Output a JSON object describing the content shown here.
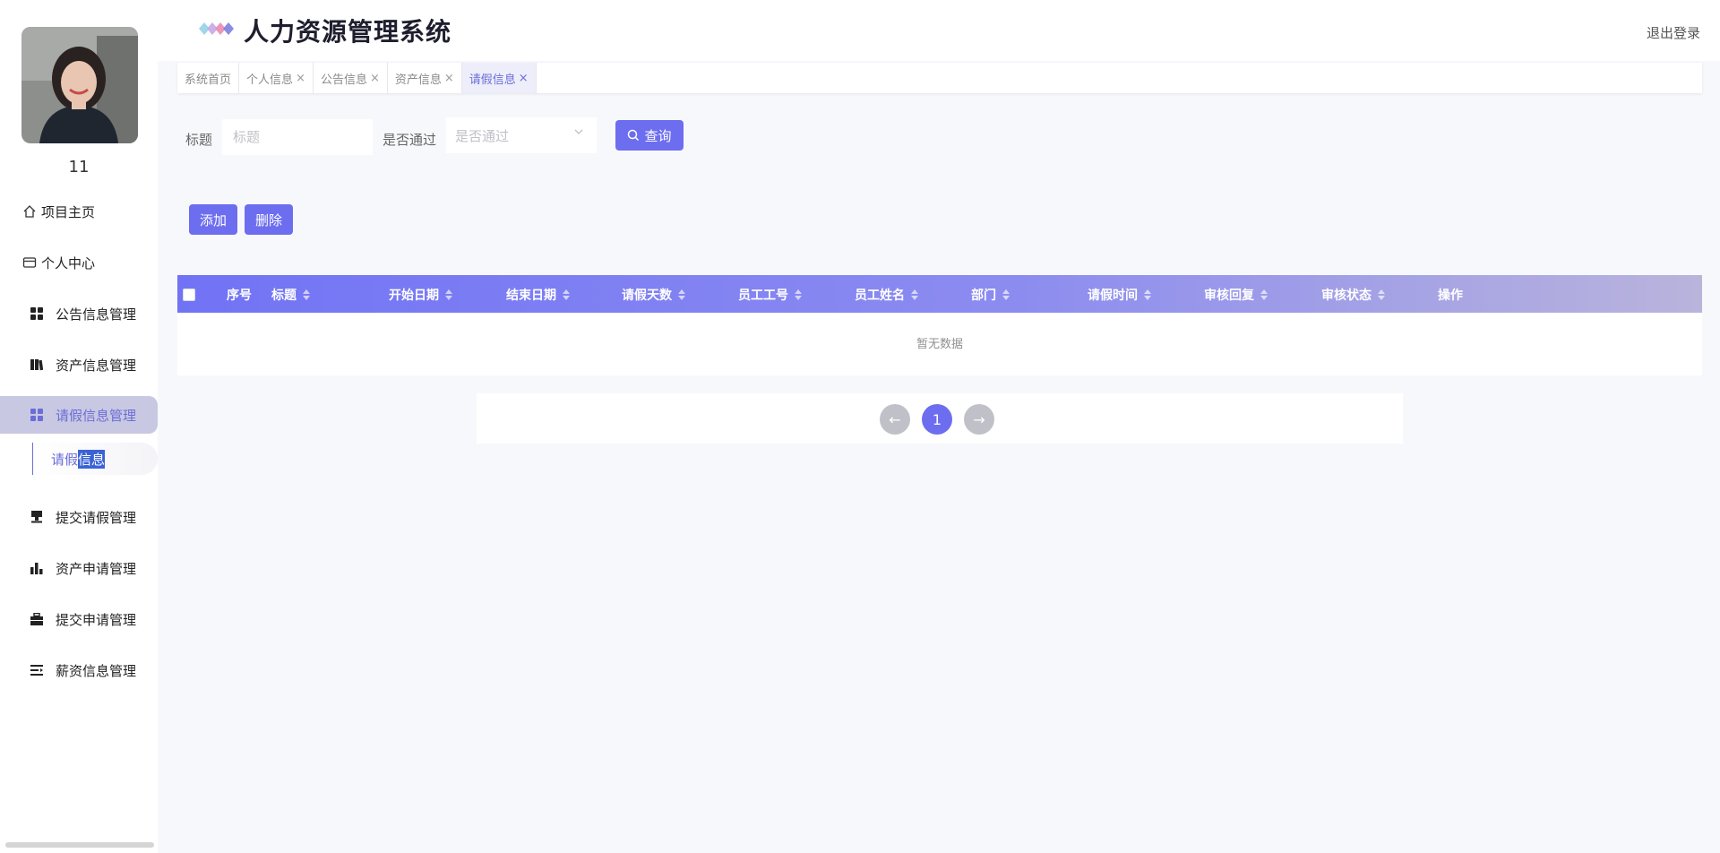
{
  "sidebar": {
    "username": "11",
    "items": [
      {
        "label": "项目主页"
      },
      {
        "label": "个人中心"
      },
      {
        "label": "公告信息管理"
      },
      {
        "label": "资产信息管理"
      },
      {
        "label": "请假信息管理"
      },
      {
        "label": "提交请假管理"
      },
      {
        "label": "资产申请管理"
      },
      {
        "label": "提交申请管理"
      },
      {
        "label": "薪资信息管理"
      }
    ],
    "sub_item": {
      "prefix": "请假",
      "highlight": "信息"
    }
  },
  "header": {
    "title": "人力资源管理系统",
    "logout": "退出登录"
  },
  "tabs": [
    {
      "label": "系统首页"
    },
    {
      "label": "个人信息"
    },
    {
      "label": "公告信息"
    },
    {
      "label": "资产信息"
    },
    {
      "label": "请假信息"
    }
  ],
  "tab_close": "×",
  "search": {
    "title_label": "标题",
    "title_placeholder": "标题",
    "status_label": "是否通过",
    "status_placeholder": "是否通过",
    "query_button": "查询"
  },
  "actions": {
    "add": "添加",
    "delete": "删除"
  },
  "table": {
    "columns": [
      "序号",
      "标题",
      "开始日期",
      "结束日期",
      "请假天数",
      "员工工号",
      "员工姓名",
      "部门",
      "请假时间",
      "审核回复",
      "审核状态",
      "操作"
    ],
    "empty_text": "暂无数据"
  },
  "pagination": {
    "prev": "←",
    "current": "1",
    "next": "→"
  },
  "colors": {
    "accent": "#6d6df0",
    "active_nav_bg": "#c9c8e2"
  }
}
